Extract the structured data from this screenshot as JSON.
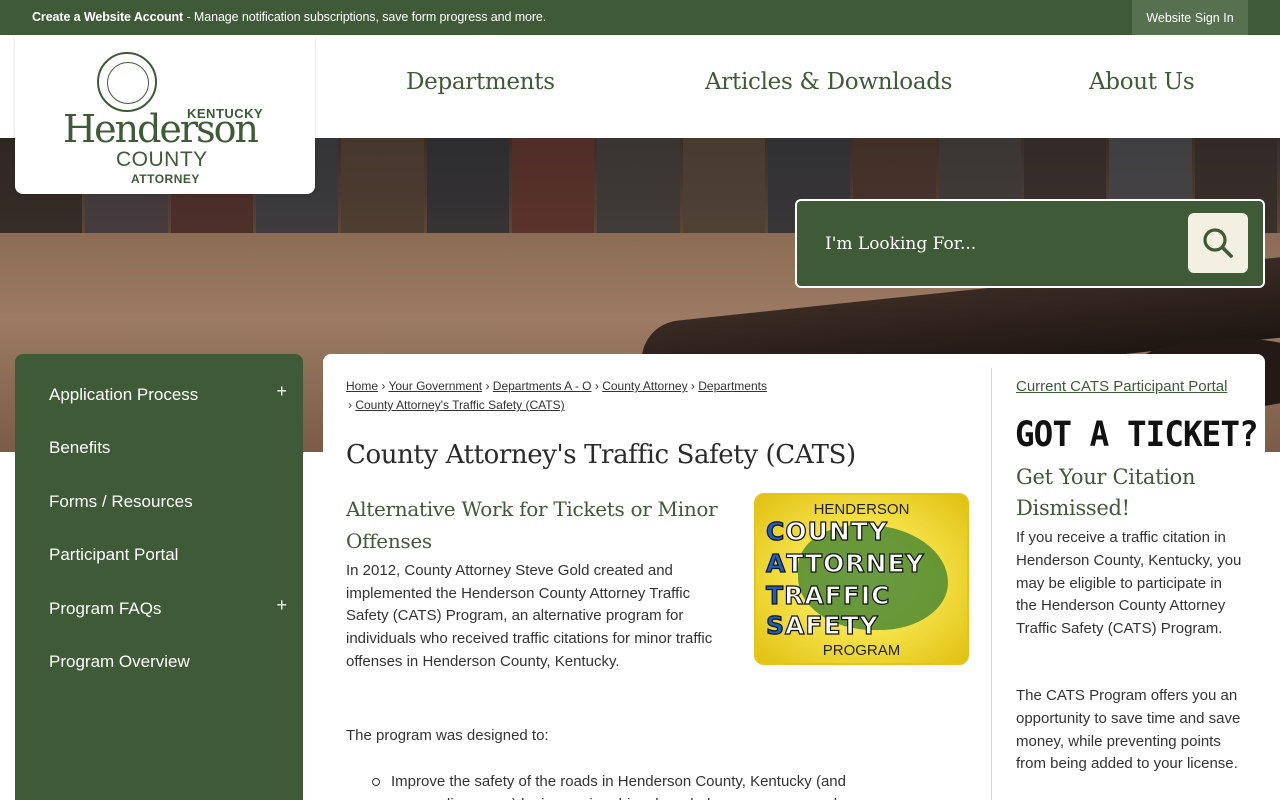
{
  "topbar": {
    "notice_bold": "Create a Website Account",
    "notice_text": " - Manage notification subscriptions, save form progress and more.",
    "signin_label": "Website Sign In"
  },
  "logo": {
    "kentucky": "KENTUCKY",
    "henderson": "Henderson",
    "county": "COUNTY",
    "attorney": "ATTORNEY"
  },
  "nav": {
    "departments": "Departments",
    "articles": "Articles & Downloads",
    "about": "About Us"
  },
  "search": {
    "placeholder": "I'm Looking For...",
    "icon": "search-icon"
  },
  "sidebar": {
    "items": [
      {
        "label": "Application Process",
        "expand": "+"
      },
      {
        "label": "Benefits"
      },
      {
        "label": "Forms / Resources"
      },
      {
        "label": "Participant Portal"
      },
      {
        "label": "Program FAQs",
        "expand": "+"
      },
      {
        "label": "Program Overview"
      }
    ]
  },
  "breadcrumb": {
    "items": [
      "Home",
      "Your Government",
      "Departments A - O",
      "County Attorney",
      "Departments",
      "County Attorney's Traffic Safety (CATS)"
    ],
    "separator": "›"
  },
  "main": {
    "title": "County Attorney's Traffic Safety (CATS)",
    "subhead": "Alternative Work for Tickets or Minor Offenses",
    "intro": "In 2012, County Attorney Steve Gold created and implemented the Henderson County Attorney Traffic Safety (CATS) Program, an alternative program for individuals who received traffic citations for minor traffic offenses in Henderson County, Kentucky.",
    "designed_label": "The program was designed to:",
    "bullets": [
      "Improve the safety of the roads in Henderson County, Kentucky (and surrounding areas) by increasing driver knowledge, awareness and"
    ]
  },
  "cats_badge": {
    "top": "HENDERSON",
    "line1_first": "C",
    "line1_rest": "OUNTY",
    "line2_first": "A",
    "line2_rest": "TTORNEY",
    "line3_first": "T",
    "line3_rest": "RAFFIC",
    "line4_first": "S",
    "line4_rest": "AFETY",
    "bottom": "PROGRAM"
  },
  "right": {
    "portal_link": "Current CATS Participant Portal",
    "got_ticket": "GOT A TICKET?",
    "citation_head": "Get Your Citation Dismissed!",
    "p1": "If you receive a traffic citation in Henderson County, Kentucky, you may be eligible to participate in the Henderson County Attorney Traffic Safety (CATS) Program.",
    "p2": "The CATS Program offers you an opportunity to save time and save money, while preventing points from being added to your license."
  },
  "colors": {
    "brand_green": "#3e5a36",
    "search_button": "#f3f0e2"
  }
}
